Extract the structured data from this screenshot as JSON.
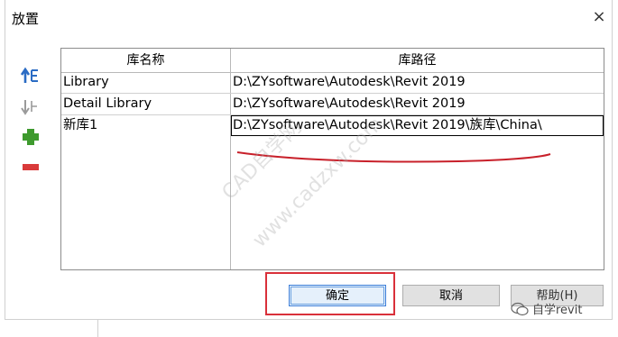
{
  "dialog": {
    "title": "放置",
    "close_label": "×"
  },
  "toolbar": {
    "move_up_icon": "arrow-up-list-icon",
    "move_down_icon": "arrow-down-list-icon",
    "add_icon": "plus-icon",
    "remove_icon": "minus-icon",
    "add_color": "#3e9a2e",
    "remove_color": "#d93a3a"
  },
  "table": {
    "headers": [
      "库名称",
      "库路径"
    ],
    "rows": [
      {
        "name": "Library",
        "path": "D:\\ZYsoftware\\Autodesk\\Revit 2019"
      },
      {
        "name": "Detail Library",
        "path": "D:\\ZYsoftware\\Autodesk\\Revit 2019"
      },
      {
        "name": "新库1",
        "path": "D:\\ZYsoftware\\Autodesk\\Revit 2019\\族库\\China\\"
      }
    ]
  },
  "buttons": {
    "ok": "确定",
    "cancel": "取消",
    "help": "帮助(H)"
  },
  "watermark": {
    "line1": "CAD自学网",
    "line2": "www.cadzxw.com",
    "brand": "自学revit"
  },
  "colors": {
    "highlight_red": "#d9303a",
    "ok_border": "#3b7dd8"
  }
}
